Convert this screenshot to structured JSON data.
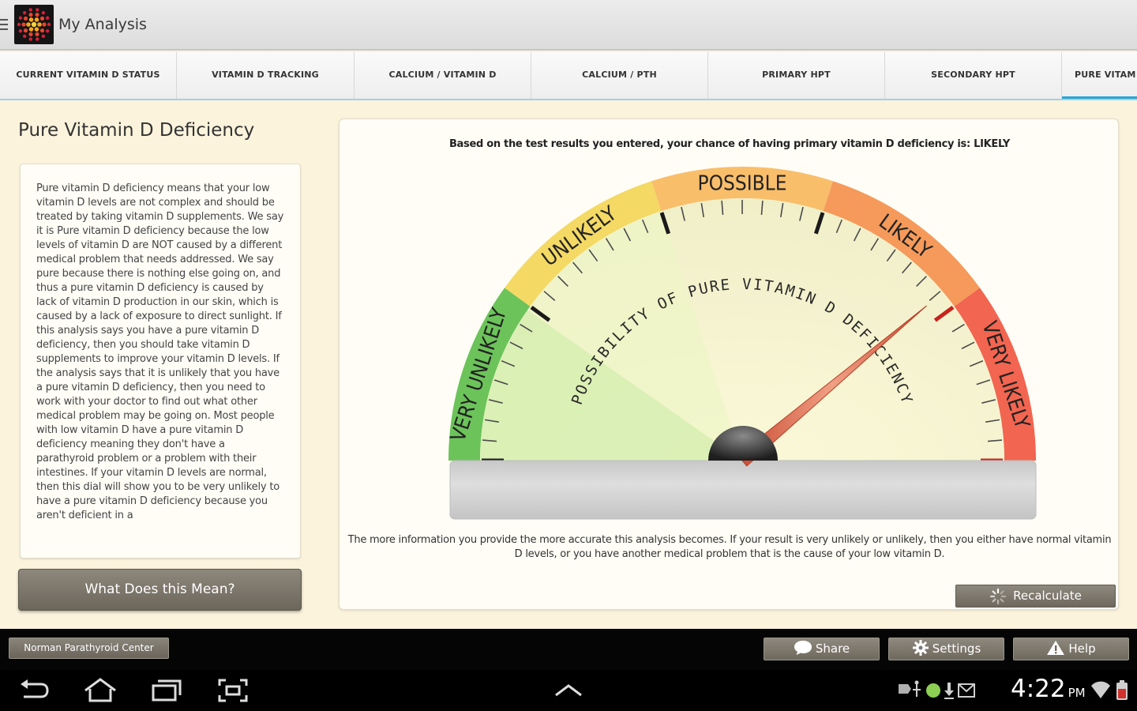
{
  "app": {
    "title": "My Analysis",
    "logo_icon": "sunburst-logo-icon"
  },
  "tabs": [
    {
      "label": "CURRENT VITAMIN D STATUS",
      "active": false
    },
    {
      "label": "VITAMIN D TRACKING",
      "active": false
    },
    {
      "label": "CALCIUM / VITAMIN D",
      "active": false
    },
    {
      "label": "CALCIUM / PTH",
      "active": false
    },
    {
      "label": "PRIMARY HPT",
      "active": false
    },
    {
      "label": "SECONDARY HPT",
      "active": false
    },
    {
      "label": "PURE VITAM",
      "active": true
    }
  ],
  "left": {
    "title": "Pure Vitamin D Deficiency",
    "description": "Pure vitamin D deficiency means that your low vitamin D levels are not complex and should be treated by taking vitamin D supplements. We say it is Pure vitamin D deficiency because the low levels of vitamin D are NOT caused by a different medical problem that needs addressed. We say pure because there is nothing else going on, and thus a pure vitamin D deficiency is caused by lack of vitamin D production in our skin, which is caused by a lack of exposure to direct sunlight. If this analysis says you have a pure vitamin D deficiency, then you should take vitamin D supplements to improve your vitamin D levels. If the analysis says that it is unlikely that you have a pure vitamin D deficiency, then you need to work with your doctor to find out what other medical problem may be going on. Most people with low vitamin D have a pure vitamin D deficiency meaning they don't have a parathyroid problem or a problem with their intestines. If your vitamin D levels are normal, then this dial will show you to be very unlikely to have a pure vitamin D deficiency because you aren't deficient in a",
    "meaning_button": "What Does this Mean?"
  },
  "gauge": {
    "result_text": "Based on the test results you entered, your chance of having primary vitamin D deficiency is: LIKELY",
    "arc_label": "POSSIBILITY OF PURE VITAMIN D DEFICIENCY",
    "segments": [
      {
        "label": "VERY UNLIKELY",
        "color": "#6cc35a"
      },
      {
        "label": "UNLIKELY",
        "color": "#f4d964"
      },
      {
        "label": "POSSIBLE",
        "color": "#f9be6a"
      },
      {
        "label": "LIKELY",
        "color": "#f59a5a"
      },
      {
        "label": "VERY LIKELY",
        "color": "#f26550"
      }
    ],
    "needle_angle_deg": 40,
    "info_text": "The more information you provide the more accurate this analysis becomes. If your result is very unlikely or unlikely, then you either have normal vitamin D levels, or you have another medical problem that is the cause of your low vitamin D.",
    "recalculate_button": "Recalculate"
  },
  "bottom": {
    "center_button": "Norman Parathyroid Center",
    "share": "Share",
    "settings": "Settings",
    "help": "Help"
  },
  "system": {
    "time": "4:22",
    "ampm": "PM"
  }
}
